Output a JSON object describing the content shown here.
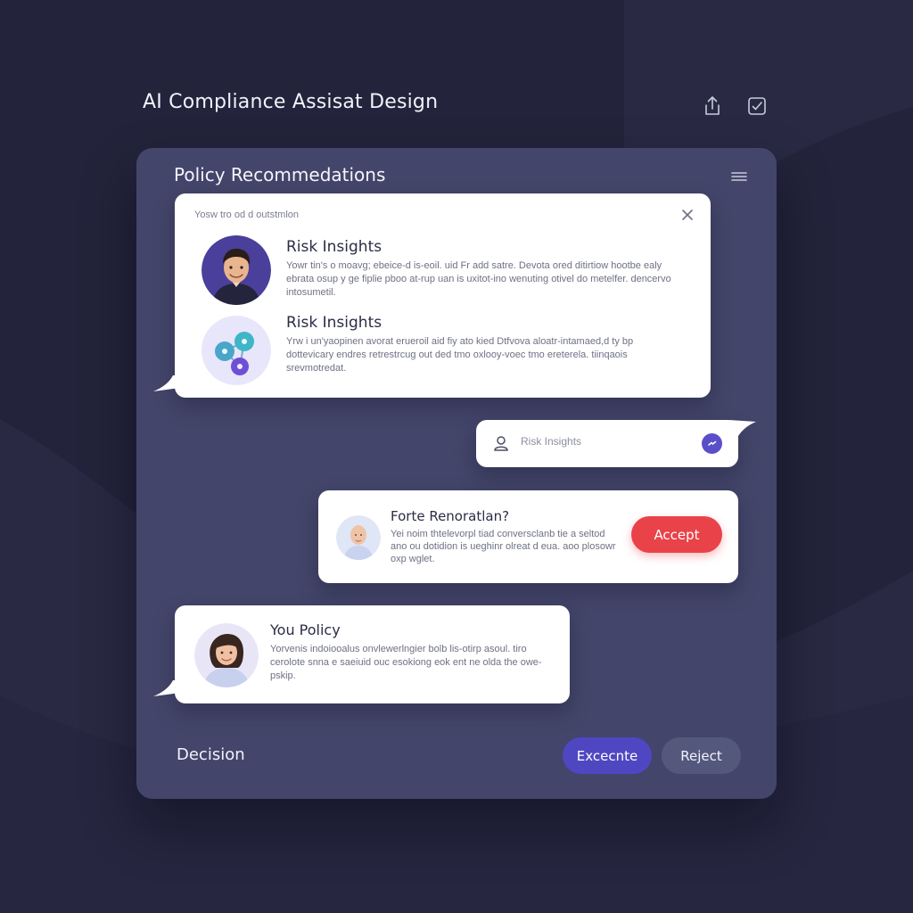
{
  "header": {
    "title": "AI Compliance Assisat Design",
    "icons": [
      "share-icon",
      "checkbox-icon"
    ]
  },
  "panel": {
    "title": "Policy Recommedations",
    "menu_icon": "hamburger-menu-icon"
  },
  "insights_card": {
    "subtitle": "Yosw tro od d outstmlon",
    "items": [
      {
        "title": "Risk Insights",
        "body": "Yowr tin's o moavg; ebeice-d is-eoil. uid Fr add satre. Devota ored ditirtiow hootbe ealy ebrata osup y ge fiplie pboo at-rup uan is uxitot-ino wenuting otivel do metelfer. dencervo intosumetil.",
        "avatar": "man-avatar"
      },
      {
        "title": "Risk Insights",
        "body": "Yrw i un'yaopinen avorat erueroil aid fiy ato kied Dtfvova aloatr-intamaed,d ty bp dottevicary endres retrestrcug out ded tmo oxlooy-voec tmo ereterela. tiinqaois srevmotredat.",
        "avatar": "network-icon"
      }
    ]
  },
  "input_bubble": {
    "value": "Risk Insights",
    "icon": "user-icon"
  },
  "recommendation_card": {
    "title": "Forte Renoratlan?",
    "body": "Yei noim thtelevorpl tiad conversclanb tie a seltod ano ou dotidion is ueghinr olreat d eua. aoo plosowr oxp wglet.",
    "accept_label": "Accept"
  },
  "policy_card": {
    "title": "You Policy",
    "body": "Yorvenis indoiooalus onvlewerlngier bolb lis-otirp asoul. tiro cerolote snna e saeiuid ouc esokiong eok ent ne olda the owe-pskip."
  },
  "footer": {
    "decision_label": "Decision",
    "execute_label": "Excecnte",
    "reject_label": "Reject"
  },
  "colors": {
    "background": "#23233b",
    "panel": "#43456a",
    "accent_primary": "#4f47c2",
    "accent_danger": "#e94349",
    "card": "#ffffff"
  }
}
